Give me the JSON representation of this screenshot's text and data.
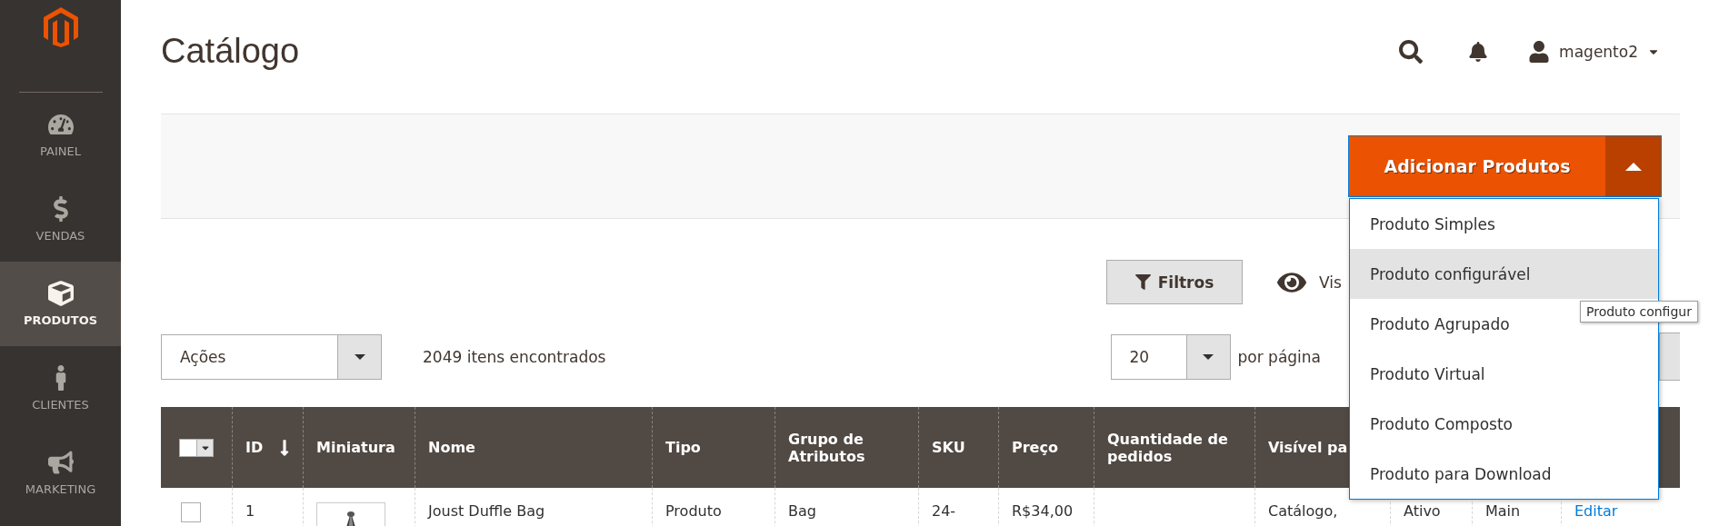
{
  "sidebar": {
    "items": [
      {
        "label": "PAINEL",
        "kind": "dashboard",
        "selected": false
      },
      {
        "label": "VENDAS",
        "kind": "sales",
        "selected": false
      },
      {
        "label": "PRODUTOS",
        "kind": "products",
        "selected": true
      },
      {
        "label": "CLIENTES",
        "kind": "customers",
        "selected": false
      },
      {
        "label": "MARKETING",
        "kind": "marketing",
        "selected": false
      }
    ]
  },
  "header": {
    "title": "Catálogo",
    "user": "magento2"
  },
  "page_actions": {
    "add_button": "Adicionar Produtos",
    "expanded": true,
    "menu": [
      {
        "label": "Produto Simples",
        "selected": false
      },
      {
        "label": "Produto configurável",
        "selected": true
      },
      {
        "label": "Produto Agrupado",
        "selected": false
      },
      {
        "label": "Produto Virtual",
        "selected": false
      },
      {
        "label": "Produto Composto",
        "selected": false
      },
      {
        "label": "Produto para Download",
        "selected": false
      }
    ],
    "tooltip": "Produto configur"
  },
  "toolbar": {
    "filters": "Filtros",
    "columns_label": "Vis",
    "actions": "Ações",
    "count": "2049 itens encontrados",
    "per_page": "20",
    "per_page_label": "por página"
  },
  "table": {
    "columns": [
      {
        "label": "ID",
        "sorted": true
      },
      {
        "label": "Miniatura",
        "sorted": false
      },
      {
        "label": "Nome",
        "sorted": false
      },
      {
        "label": "Tipo",
        "sorted": false
      },
      {
        "label": "Grupo de Atributos",
        "sorted": false
      },
      {
        "label": "SKU",
        "sorted": false
      },
      {
        "label": "Preço",
        "sorted": false
      },
      {
        "label": "Quantidade de pedidos",
        "sorted": false
      },
      {
        "label": "Visível pa",
        "sorted": false
      }
    ],
    "rows": [
      {
        "checked": false,
        "id": "1",
        "name": "Joust Duffle Bag",
        "type": "Produto",
        "attribute_set": "Bag",
        "sku": "24-",
        "price": "R$34,00",
        "visibility": "Catálogo,",
        "status": "Ativo",
        "websites": "Main",
        "action": "Editar"
      }
    ]
  }
}
